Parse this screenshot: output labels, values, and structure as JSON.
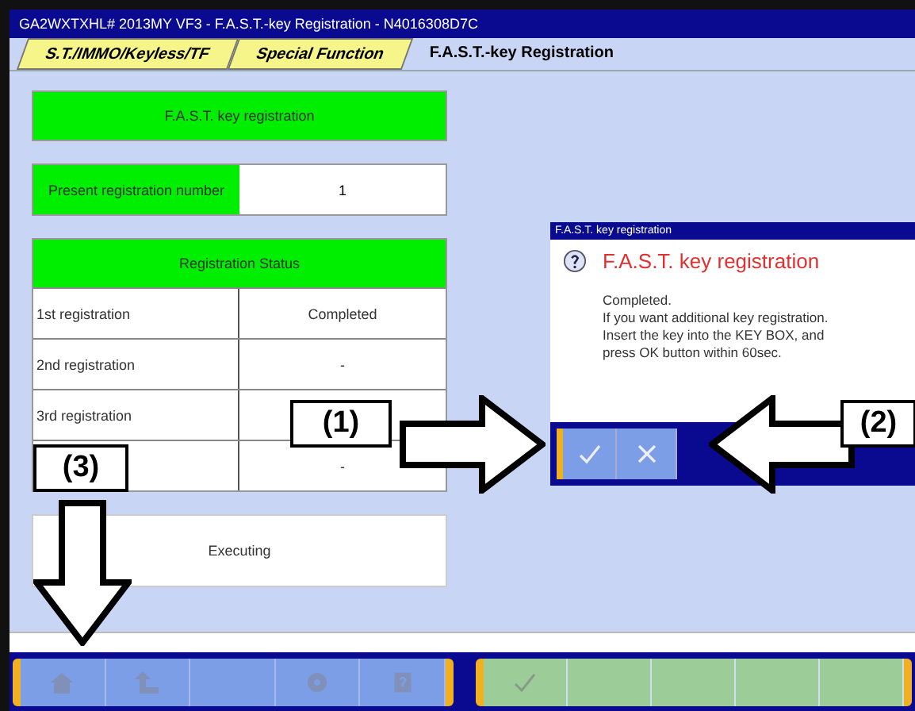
{
  "window": {
    "title": "GA2WXTXHL# 2013MY VF3  -  F.A.S.T.-key Registration  -  N4016308D7C"
  },
  "tabs": [
    {
      "label": "S.T./IMMO/Keyless/TF",
      "selected": false
    },
    {
      "label": "Special Function",
      "selected": false
    },
    {
      "label": "F.A.S.T.-key Registration",
      "selected": true
    }
  ],
  "panel": {
    "header": "F.A.S.T. key registration",
    "present_label": "Present registration number",
    "present_value": "1",
    "status_header": "Registration Status",
    "rows": [
      {
        "label": "1st registration",
        "value": "Completed"
      },
      {
        "label": "2nd registration",
        "value": "-"
      },
      {
        "label": "3rd registration"
      },
      {
        "value": "-"
      }
    ],
    "status": "Executing"
  },
  "dialog": {
    "title": "F.A.S.T. key registration",
    "heading": "F.A.S.T. key registration",
    "lines": [
      "Completed.",
      "If you want additional key registration.",
      "Insert the key into the KEY BOX, and",
      "press OK button within 60sec."
    ],
    "buttons": [
      {
        "kind": "ok"
      },
      {
        "kind": "cancel"
      }
    ]
  },
  "toolbar_left": [
    {
      "kind": "home"
    },
    {
      "kind": "up"
    },
    {
      "kind": "blank"
    },
    {
      "kind": "gear"
    },
    {
      "kind": "help"
    }
  ],
  "toolbar_right": [
    {
      "kind": "check",
      "disabled": true
    },
    {
      "kind": "blank",
      "disabled": true
    },
    {
      "kind": "blank",
      "disabled": true
    },
    {
      "kind": "blank",
      "disabled": true
    },
    {
      "kind": "blank",
      "disabled": true
    }
  ],
  "callouts": [
    {
      "label": "(1)",
      "kind": "right"
    },
    {
      "label": "(2)",
      "kind": "left"
    },
    {
      "label": "(3)",
      "kind": "down"
    }
  ]
}
